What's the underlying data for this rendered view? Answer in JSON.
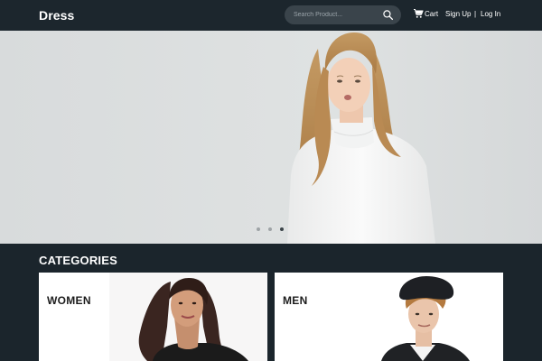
{
  "header": {
    "brand": "Dress",
    "search_placeholder": "Search Product...",
    "cart_label": "Cart",
    "signup_label": "Sign Up",
    "separator": "|",
    "login_label": "Log In"
  },
  "hero": {
    "slides_total": 3,
    "active_slide": 3
  },
  "categories": {
    "title": "CATEGORIES",
    "items": [
      {
        "label": "WOMEN"
      },
      {
        "label": "MEN"
      }
    ]
  },
  "colors": {
    "header_bg": "#1c262d",
    "page_bg": "#1b252c",
    "hero_bg": "#d9dcdd",
    "search_bg": "#3a444b"
  }
}
